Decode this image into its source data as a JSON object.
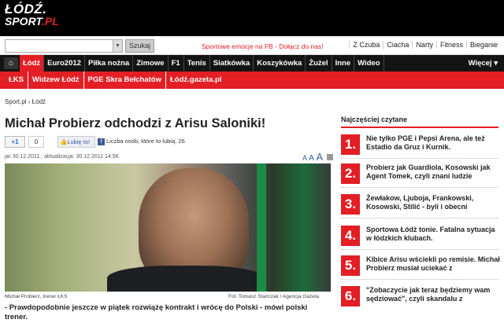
{
  "brand": {
    "line1": "ŁÓDŹ.",
    "line2": "SPORT",
    "line2_suffix": ".PL"
  },
  "search": {
    "button_label": "Szukaj",
    "value": ""
  },
  "promo": "Sportowe emocje na FB - Dołącz do nas!",
  "top_links": [
    "Z Czuba",
    "Ciacha",
    "Narty",
    "Fitness",
    "Bieganie"
  ],
  "nav": {
    "home_icon": "home-icon",
    "items": [
      "Łódź",
      "Euro2012",
      "Piłka nożna",
      "Zimowe",
      "F1",
      "Tenis",
      "Siatkówka",
      "Koszykówka",
      "Żużel",
      "Inne",
      "Wideo"
    ],
    "more_label": "Więcej"
  },
  "subnav": [
    "ŁKS",
    "Widzew Łódź",
    "PGE Skra Bełchatów",
    "Łódź.gazeta.pl"
  ],
  "breadcrumb": "Sport.pl › Łódź",
  "article": {
    "title": "Michał Probierz odchodzi z Arisu Saloniki!",
    "gplus_label": "+1",
    "gplus_count": "0",
    "fb_like": "Lubię to!",
    "fb_text": "Liczba osób, które to lubią: 26.",
    "meta": "jar   30.12.2011 , aktualizacja: 30.12.2011 14:56",
    "font_sizes": [
      "A",
      "A",
      "A"
    ],
    "caption": "Michał Probierz, trener ŁKS",
    "credit": "Fot. Tomasz Stańczak / Agencja Gazeta",
    "lead": "- Prawdopodobnie jeszcze w piątek rozwiążę kontrakt i wrócę do Polski - mówi polski trener."
  },
  "sidebar": {
    "title": "Najczęściej czytane",
    "items": [
      {
        "num": "1.",
        "text": "Nie tylko PGE i Pepsi Arena, ale też Estadio da Gruz i Kurnik."
      },
      {
        "num": "2.",
        "text": "Probierz jak Guardiola, Kosowski jak Agent Tomek, czyli znani ludzie"
      },
      {
        "num": "3.",
        "text": "Żewłakow, Ljuboja, Frankowski, Kosowski, Stilić - byli i obecni"
      },
      {
        "num": "4.",
        "text": "Sportowa Łódź tonie. Fatalna sytuacja w łódzkich klubach."
      },
      {
        "num": "5.",
        "text": "Kibice Arisu wściekli po remisie. Michał Probierz musiał uciekać z"
      },
      {
        "num": "6.",
        "text": "\"Zobaczycie jak teraz będziemy wam sędziować\", czyli skandalu z"
      }
    ]
  },
  "colors": {
    "accent": "#e31e24",
    "dark": "#141414"
  }
}
